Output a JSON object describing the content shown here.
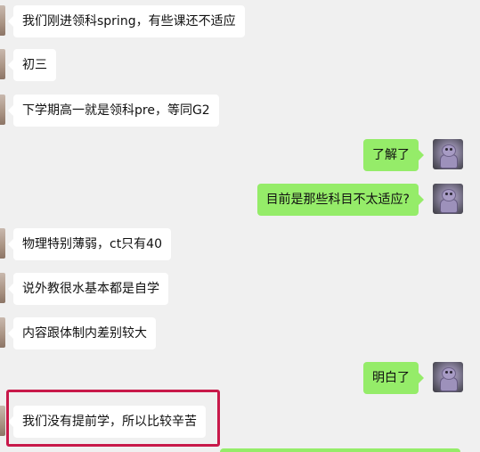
{
  "messages": [
    {
      "side": "left",
      "text": "我们刚进领科spring，有些课还不适应"
    },
    {
      "side": "left",
      "text": "初三"
    },
    {
      "side": "left",
      "text": "下学期高一就是领科pre，等同G2"
    },
    {
      "side": "right",
      "text": "了解了"
    },
    {
      "side": "right",
      "text": "目前是那些科目不太适应?"
    },
    {
      "side": "left",
      "text": "物理特别薄弱，ct只有40"
    },
    {
      "side": "left",
      "text": "说外教很水基本都是自学"
    },
    {
      "side": "left",
      "text": "内容跟体制内差别较大"
    },
    {
      "side": "right",
      "text": "明白了"
    },
    {
      "side": "left",
      "text": "我们没有提前学，所以比较辛苦",
      "highlighted": true
    }
  ],
  "colors": {
    "background": "#f0f0f0",
    "left_bubble": "#ffffff",
    "right_bubble": "#95ec69",
    "highlight_border": "#c8194a"
  }
}
